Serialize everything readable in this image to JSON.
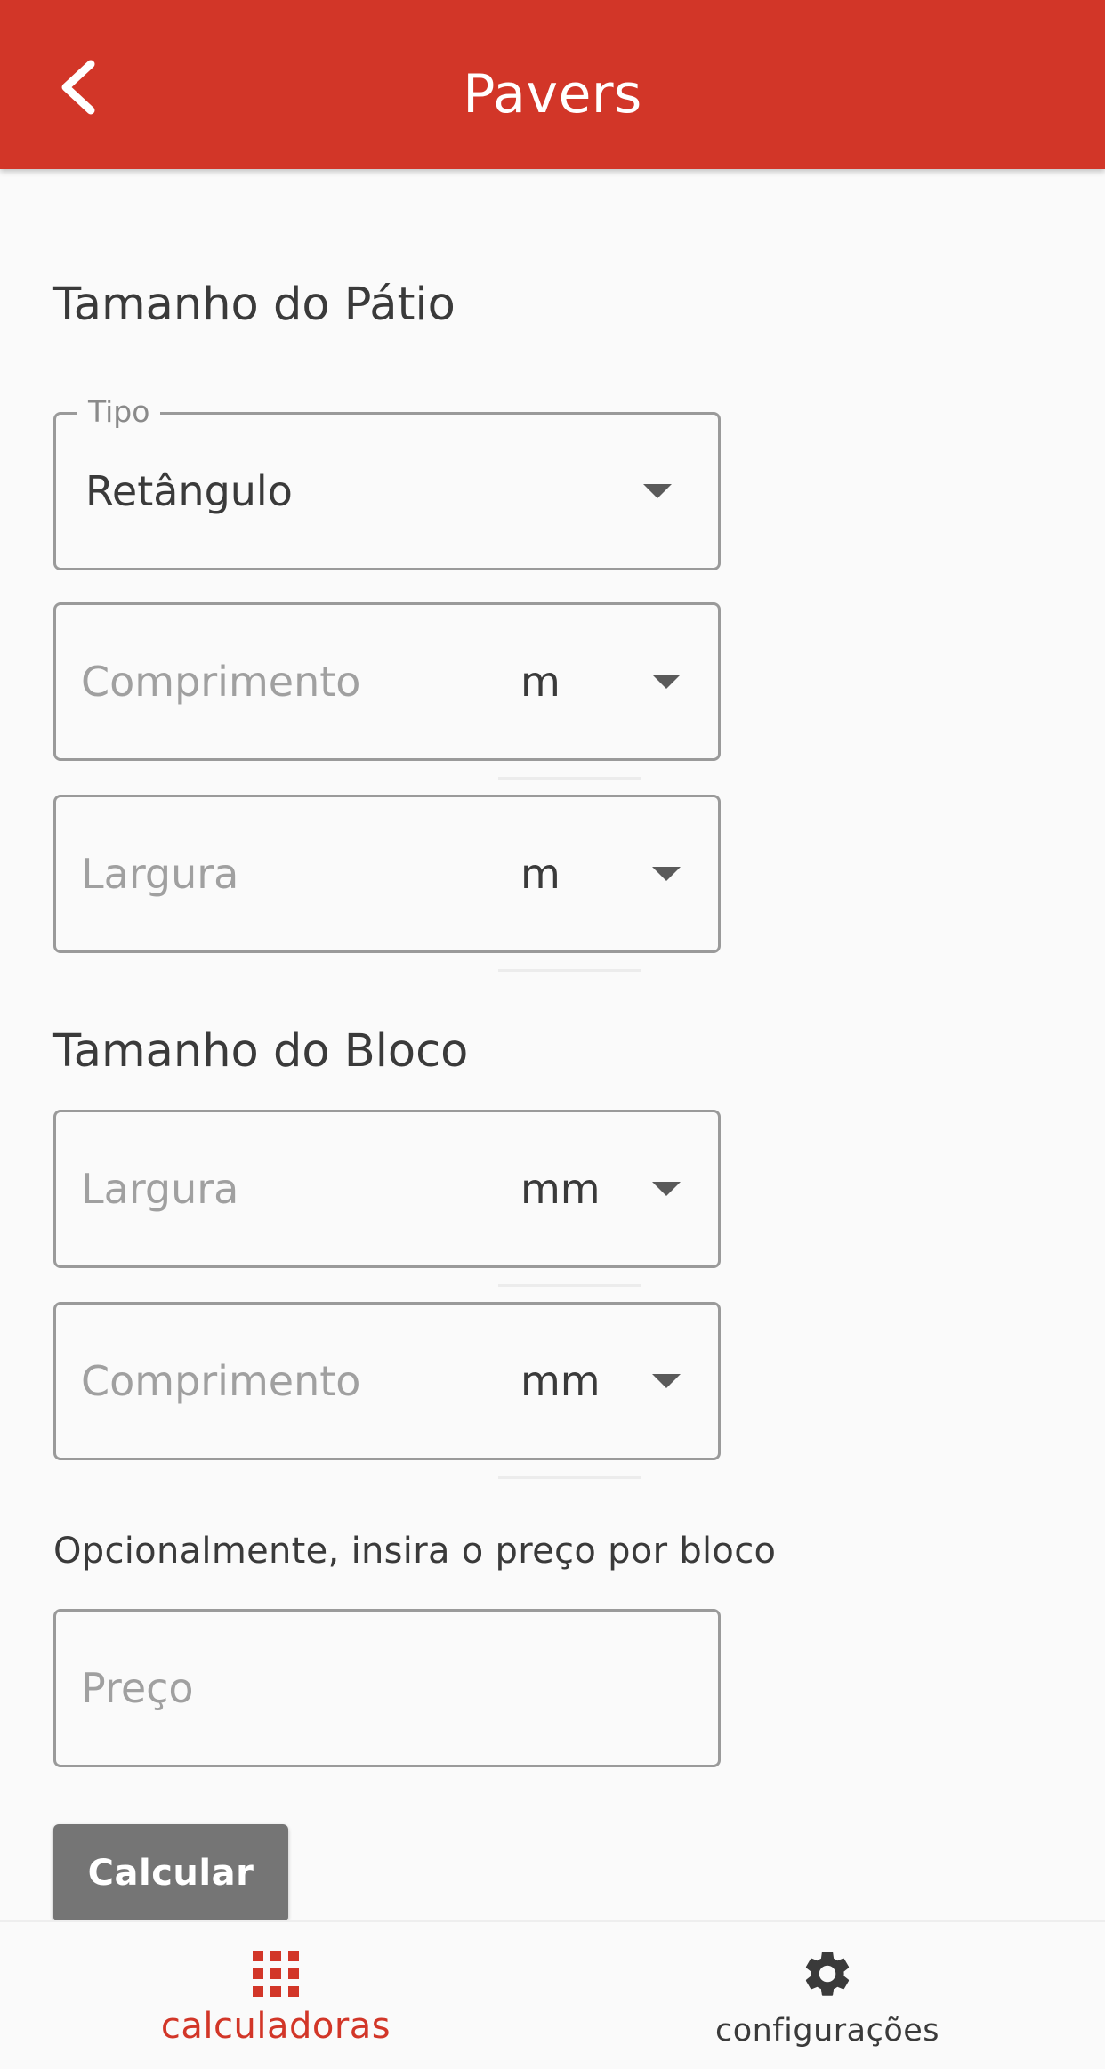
{
  "appbar": {
    "title": "Pavers",
    "background_color": "#d23628",
    "back_icon": "chevron-left-icon"
  },
  "patio_section": {
    "title": "Tamanho do Pátio",
    "type_field": {
      "legend": "Tipo",
      "value": "Retângulo"
    },
    "length_field": {
      "placeholder": "Comprimento",
      "unit": "m"
    },
    "width_field": {
      "placeholder": "Largura",
      "unit": "m"
    }
  },
  "block_section": {
    "title": "Tamanho do Bloco",
    "width_field": {
      "placeholder": "Largura",
      "unit": "mm"
    },
    "length_field": {
      "placeholder": "Comprimento",
      "unit": "mm"
    }
  },
  "price_section": {
    "hint": "Opcionalmente, insira o preço por bloco",
    "price_field": {
      "placeholder": "Preço"
    }
  },
  "calculate_button": {
    "label": "Calcular"
  },
  "bottom_nav": {
    "items": [
      {
        "label": "calculadoras",
        "icon": "grid-icon",
        "active": true,
        "color": "#d23628"
      },
      {
        "label": "configurações",
        "icon": "gear-icon",
        "active": false,
        "color": "#3a3a3a"
      }
    ]
  }
}
